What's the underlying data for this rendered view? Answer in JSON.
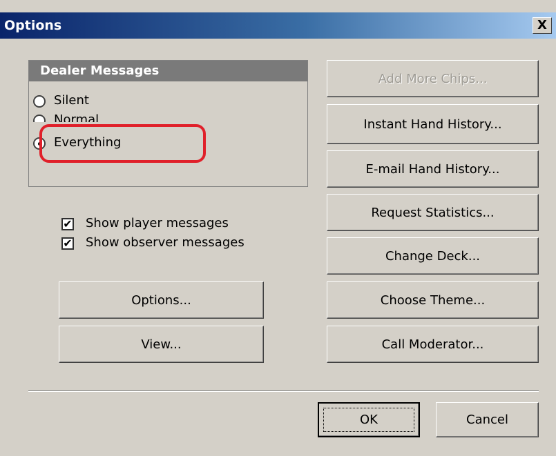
{
  "window": {
    "title": "Options",
    "close_glyph": "X"
  },
  "dealer_messages": {
    "header": "Dealer Messages",
    "options": [
      {
        "label": "Silent",
        "selected": false
      },
      {
        "label": "Normal",
        "selected": false
      },
      {
        "label": "Everything",
        "selected": true
      }
    ]
  },
  "checkboxes": [
    {
      "label": "Show player messages",
      "checked": true
    },
    {
      "label": "Show observer messages",
      "checked": true
    }
  ],
  "left_buttons": {
    "options": "Options...",
    "view": "View..."
  },
  "right_buttons": {
    "add_more_chips": "Add More Chips...",
    "instant_hand_history": "Instant Hand History...",
    "email_hand_history": "E-mail Hand History...",
    "request_statistics": "Request Statistics...",
    "change_deck": "Change Deck...",
    "choose_theme": "Choose Theme...",
    "call_moderator": "Call Moderator..."
  },
  "footer": {
    "ok": "OK",
    "cancel": "Cancel"
  },
  "colors": {
    "title_gradient_start": "#0a246a",
    "title_gradient_end": "#a6caf0",
    "highlight": "#e0202a",
    "dialog_bg": "#d4d0c8"
  }
}
